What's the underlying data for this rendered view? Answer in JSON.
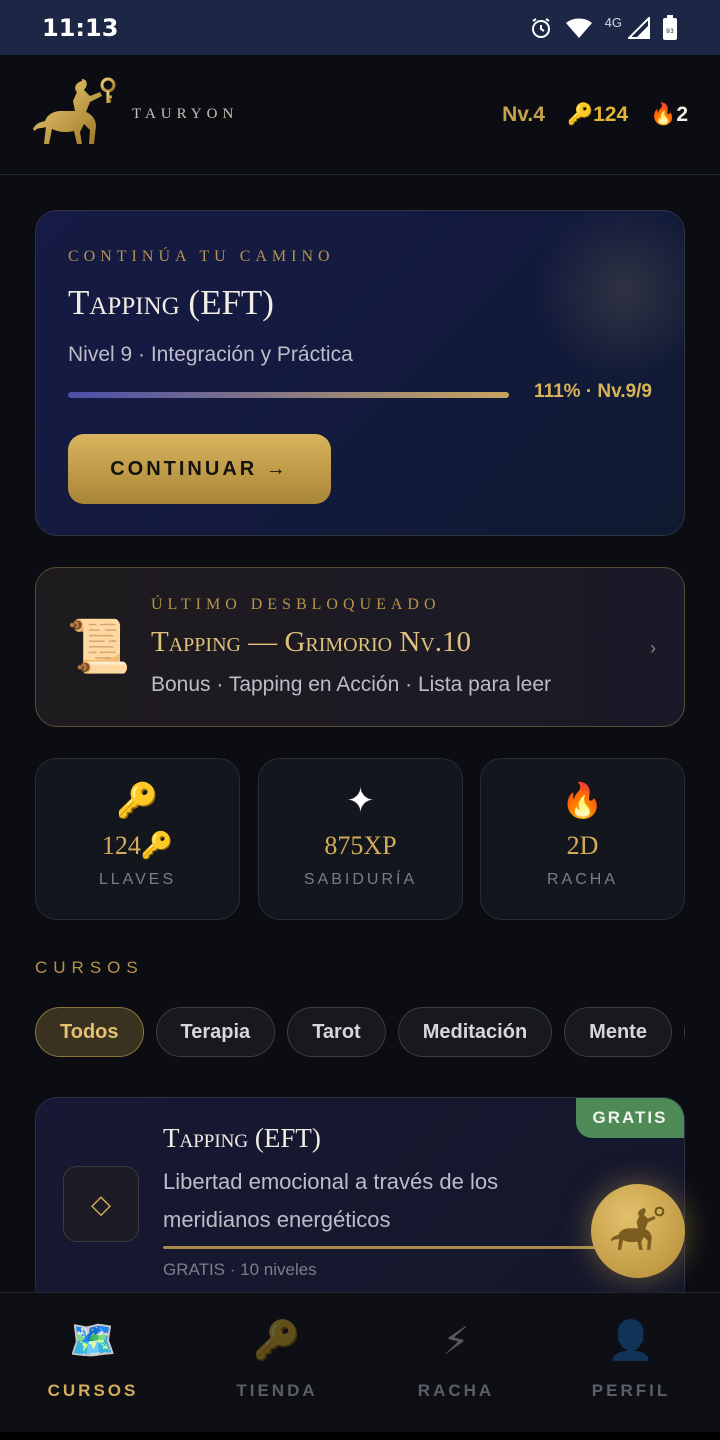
{
  "status_bar": {
    "time": "11:13",
    "network": "4G",
    "battery": "93"
  },
  "header": {
    "brand": "TAURYON",
    "level": "Nv.4",
    "keys": "124",
    "streak": "2"
  },
  "hero": {
    "eyebrow": "CONTINÚA TU CAMINO",
    "title": "Tapping (EFT)",
    "subtitle": "Nivel 9 · Integración y Práctica",
    "progress": 1.11,
    "progress_label": "111% · Nv.9/9",
    "button": "CONTINUAR →"
  },
  "last_unlocked": {
    "eyebrow": "ÚLTIMO DESBLOQUEADO",
    "title": "Tapping — Grimorio Nv.10",
    "subtitle": "Bonus · Tapping en Acción · Lista para leer",
    "chevron": "›"
  },
  "stats": [
    {
      "icon": "🔑",
      "value": "124🔑",
      "label": "LLAVES"
    },
    {
      "icon": "✦",
      "value": "875XP",
      "label": "SABIDURÍA"
    },
    {
      "icon": "🔥",
      "value": "2D",
      "label": "RACHA"
    }
  ],
  "courses": {
    "title": "CURSOS",
    "filters": [
      "Todos",
      "Terapia",
      "Tarot",
      "Meditación",
      "Mente",
      ""
    ],
    "active_filter": "Todos",
    "items": [
      {
        "badge": "GRATIS",
        "icon": "◇",
        "title": "Tapping (EFT)",
        "description": "Libertad emocional a través de los meridianos energéticos",
        "meta": "GRATIS · 10 niveles"
      }
    ]
  },
  "tabbar": [
    {
      "icon": "🗺️",
      "label": "CURSOS",
      "active": true
    },
    {
      "icon": "🔑",
      "label": "TIENDA",
      "active": false
    },
    {
      "icon": "⚡",
      "label": "RACHA",
      "active": false
    },
    {
      "icon": "👤",
      "label": "PERFIL",
      "active": false
    }
  ],
  "colors": {
    "accent_gold": "#d3ad58",
    "badge_green": "#4d8a56",
    "background": "#0b0d13"
  }
}
